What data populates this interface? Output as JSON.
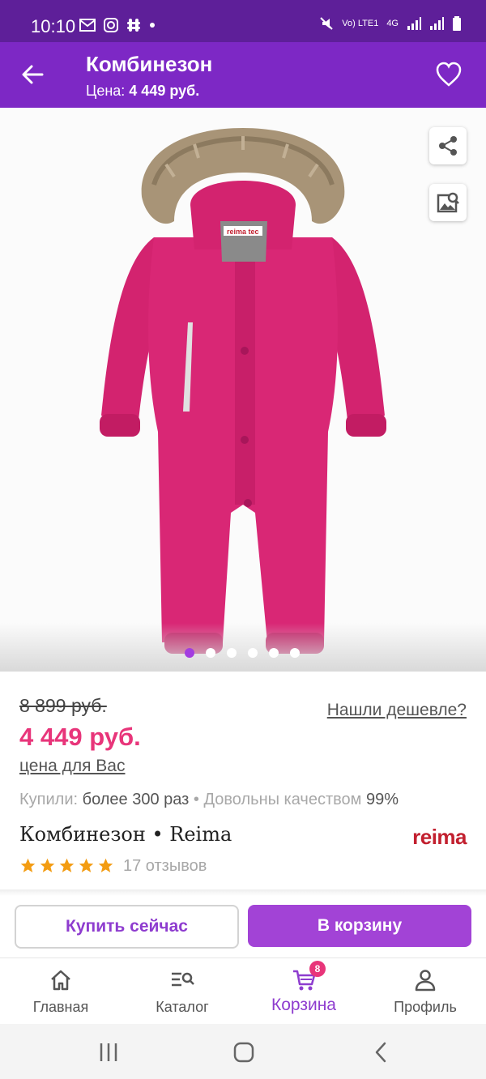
{
  "status_bar": {
    "time": "10:10",
    "network": "4G",
    "volte": "Vo) LTE1"
  },
  "header": {
    "title": "Комбинезон",
    "price_label": "Цена:",
    "price_value": "4 449 руб."
  },
  "gallery": {
    "image_count": 6,
    "active_index": 0,
    "image_label": "reima tec"
  },
  "pricing": {
    "old_price": "8 899 руб.",
    "new_price": "4 449 руб.",
    "your_price_link": "цена для Вас",
    "cheaper_link": "Нашли дешевле?"
  },
  "stats": {
    "bought_label": "Купили:",
    "bought_value": "более 300 раз",
    "separator": "•",
    "quality_label": "Довольны качеством",
    "quality_value": "99%"
  },
  "product": {
    "name": "Комбинезон • Reima",
    "brand_logo": "reima"
  },
  "rating": {
    "stars": 5,
    "max_stars": 5,
    "reviews": "17 отзывов"
  },
  "actions": {
    "buy_now": "Купить сейчас",
    "add_to_cart": "В корзину"
  },
  "bottom_nav": {
    "items": [
      {
        "label": "Главная",
        "icon": "home-icon"
      },
      {
        "label": "Каталог",
        "icon": "catalog-search-icon"
      },
      {
        "label": "Корзина",
        "icon": "cart-icon",
        "badge": "8"
      },
      {
        "label": "Профиль",
        "icon": "profile-icon"
      }
    ],
    "active": "Корзина"
  },
  "colors": {
    "status_bar": "#5e1f99",
    "app_bar": "#7d28c5",
    "accent_price": "#e8357a",
    "primary_button": "#a243d6",
    "star": "#f39c12",
    "brand": "#c2202f",
    "garment": "#d3236f"
  }
}
